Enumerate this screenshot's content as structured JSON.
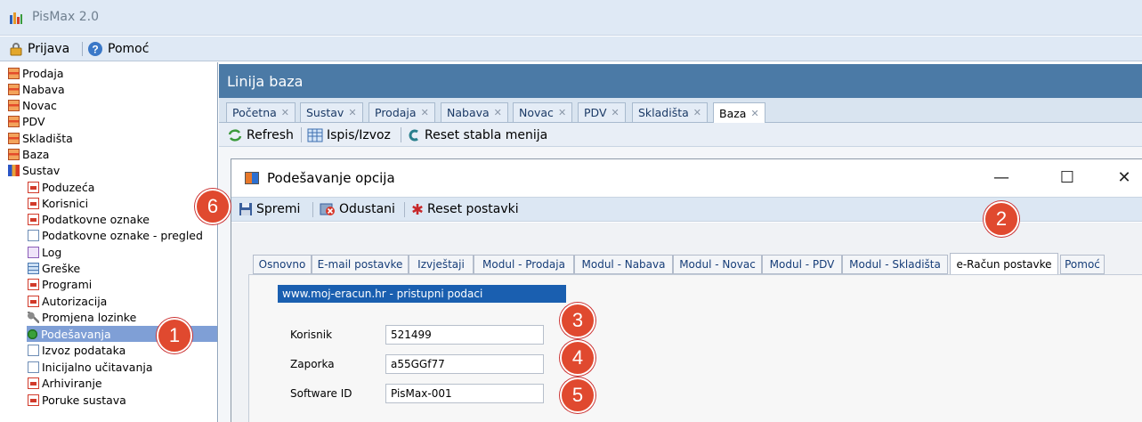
{
  "app": {
    "title": "PisMax 2.0"
  },
  "menubar": {
    "login_label": "Prijava",
    "help_label": "Pomoć"
  },
  "tree": {
    "items": [
      {
        "label": "Prodaja",
        "icon": "folder-icon"
      },
      {
        "label": "Nabava",
        "icon": "folder-icon"
      },
      {
        "label": "Novac",
        "icon": "folder-icon"
      },
      {
        "label": "PDV",
        "icon": "folder-icon"
      },
      {
        "label": "Skladišta",
        "icon": "folder-icon"
      },
      {
        "label": "Baza",
        "icon": "folder-icon"
      },
      {
        "label": "Sustav",
        "icon": "sustav-icon"
      },
      {
        "label": "Poduzeća",
        "icon": "form-icon"
      },
      {
        "label": "Korisnici",
        "icon": "form-icon"
      },
      {
        "label": "Podatkovne oznake",
        "icon": "form-icon"
      },
      {
        "label": "Podatkovne oznake - pregled",
        "icon": "document-icon"
      },
      {
        "label": "Log",
        "icon": "log-icon"
      },
      {
        "label": "Greške",
        "icon": "grid-icon"
      },
      {
        "label": "Programi",
        "icon": "form-icon"
      },
      {
        "label": "Autorizacija",
        "icon": "form-icon"
      },
      {
        "label": "Promjena lozinke",
        "icon": "key-icon"
      },
      {
        "label": "Podešavanja",
        "icon": "settings-icon"
      },
      {
        "label": "Izvoz podataka",
        "icon": "document-icon"
      },
      {
        "label": "Inicijalno učitavanja",
        "icon": "document-icon"
      },
      {
        "label": "Arhiviranje",
        "icon": "form-icon"
      },
      {
        "label": "Poruke sustava",
        "icon": "form-icon"
      }
    ]
  },
  "main": {
    "header": "Linija baza",
    "tabs": [
      "Početna",
      "Sustav",
      "Prodaja",
      "Nabava",
      "Novac",
      "PDV",
      "Skladišta",
      "Baza"
    ],
    "toolbar": {
      "refresh": "Refresh",
      "print_export": "Ispis/Izvoz",
      "reset_tree": "Reset stabla menija"
    }
  },
  "dialog": {
    "title": "Podešavanje opcija",
    "toolbar": {
      "save": "Spremi",
      "cancel": "Odustani",
      "reset": "Reset postavki"
    },
    "tabs": [
      "Osnovno",
      "E-mail postavke",
      "Izvještaji",
      "Modul - Prodaja",
      "Modul - Nabava",
      "Modul - Novac",
      "Modul - PDV",
      "Modul - Skladišta",
      "e-Račun postavke",
      "Pomoć"
    ],
    "active_tab": "e-Račun postavke",
    "section_title": "www.moj-eracun.hr - pristupni podaci",
    "fields": {
      "user_label": "Korisnik",
      "user_value": "521499",
      "password_label": "Zaporka",
      "password_value": "a55GGf77",
      "software_label": "Software ID",
      "software_value": "PisMax-001"
    }
  },
  "callouts": [
    "1",
    "2",
    "3",
    "4",
    "5",
    "6"
  ],
  "colors": {
    "header_blue": "#4b7aa6",
    "selection": "#7f9fd6",
    "badge_red": "#e0492f",
    "section_blue": "#1a5fb0"
  }
}
